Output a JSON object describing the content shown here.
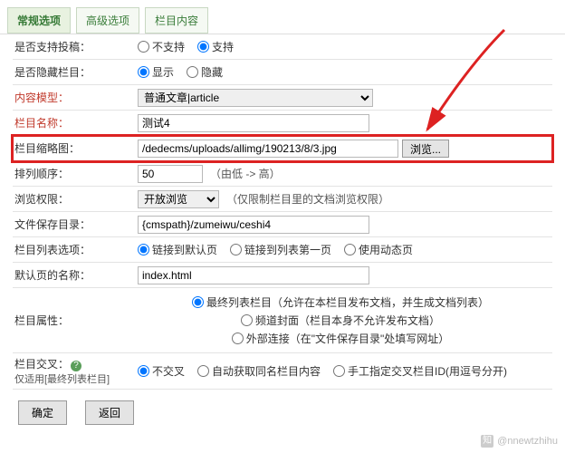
{
  "tabs": {
    "t0": "常规选项",
    "t1": "高级选项",
    "t2": "栏目内容"
  },
  "rows": {
    "submit": {
      "label": "是否支持投稿：",
      "opt_no": "不支持",
      "opt_yes": "支持"
    },
    "hide": {
      "label": "是否隐藏栏目：",
      "opt_show": "显示",
      "opt_hide": "隐藏"
    },
    "model": {
      "label": "内容模型：",
      "value": "普通文章|article"
    },
    "name": {
      "label": "栏目名称：",
      "value": "测试4"
    },
    "thumb": {
      "label": "栏目缩略图：",
      "value": "/dedecms/uploads/allimg/190213/8/3.jpg",
      "browse": "浏览..."
    },
    "sort": {
      "label": "排列顺序：",
      "value": "50",
      "hint": "（由低 -> 高）"
    },
    "perm": {
      "label": "浏览权限：",
      "value": "开放浏览",
      "hint": "（仅限制栏目里的文档浏览权限）"
    },
    "savedir": {
      "label": "文件保存目录：",
      "value": "{cmspath}/zumeiwu/ceshi4"
    },
    "listopt": {
      "label": "栏目列表选项：",
      "o1": "链接到默认页",
      "o2": "链接到列表第一页",
      "o3": "使用动态页"
    },
    "default": {
      "label": "默认页的名称：",
      "value": "index.html"
    },
    "attr": {
      "label": "栏目属性：",
      "o1": "最终列表栏目（允许在本栏目发布文档，并生成文档列表）",
      "o2": "频道封面（栏目本身不允许发布文档）",
      "o3": "外部连接（在\"文件保存目录\"处填写网址）"
    },
    "cross": {
      "label": "栏目交叉：",
      "sub": "仅适用[最终列表栏目]",
      "o1": "不交叉",
      "o2": "自动获取同名栏目内容",
      "o3": "手工指定交叉栏目ID(用逗号分开)"
    }
  },
  "buttons": {
    "ok": "确定",
    "back": "返回"
  },
  "watermark": {
    "text": "@nnewtzhihu"
  }
}
